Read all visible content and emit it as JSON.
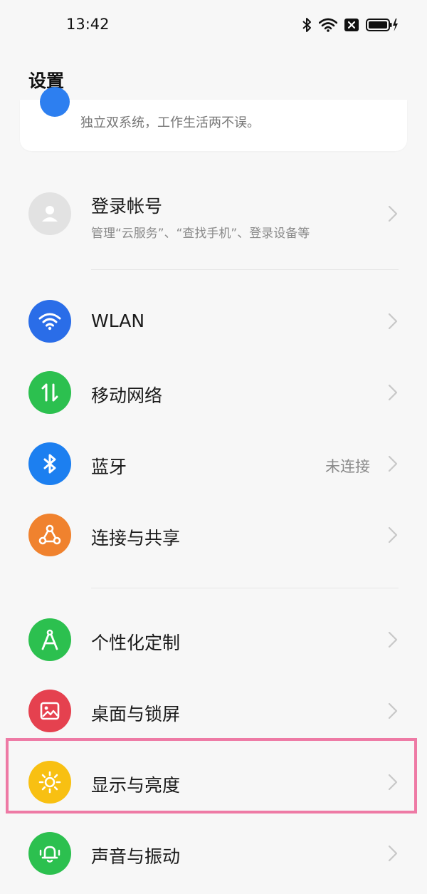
{
  "status": {
    "time": "13:42",
    "icons": [
      "bluetooth-icon",
      "wifi-icon",
      "close-box-icon",
      "battery-charging-icon"
    ]
  },
  "header": {
    "title": "设置"
  },
  "top_card": {
    "description": "独立双系统，工作生活两不误。"
  },
  "account": {
    "title": "登录帐号",
    "subtitle": "管理“云服务”、“查找手机”、登录设备等"
  },
  "network_group": [
    {
      "name": "wlan",
      "label": "WLAN",
      "icon": "wifi-icon",
      "color": "#2a6de8"
    },
    {
      "name": "mobile-network",
      "label": "移动网络",
      "icon": "arrows-updown-icon",
      "color": "#2cc04f"
    },
    {
      "name": "bluetooth",
      "label": "蓝牙",
      "value": "未连接",
      "icon": "bluetooth-icon",
      "color": "#1c7ff0"
    },
    {
      "name": "connection-sharing",
      "label": "连接与共享",
      "icon": "share-nodes-icon",
      "color": "#f0822e"
    }
  ],
  "personal_group": [
    {
      "name": "personalization",
      "label": "个性化定制",
      "icon": "compass-icon",
      "color": "#2cc04f"
    },
    {
      "name": "desktop-lockscreen",
      "label": "桌面与锁屏",
      "icon": "image-icon",
      "color": "#e5414f"
    },
    {
      "name": "display-brightness",
      "label": "显示与亮度",
      "icon": "sun-icon",
      "color": "#f8c012"
    },
    {
      "name": "sound-vibration",
      "label": "声音与振动",
      "icon": "bell-icon",
      "color": "#2cc04f"
    }
  ],
  "colors": {
    "background": "#f7f7f7",
    "highlight": "#ee7aa5",
    "chevron": "#c8c8c8"
  }
}
